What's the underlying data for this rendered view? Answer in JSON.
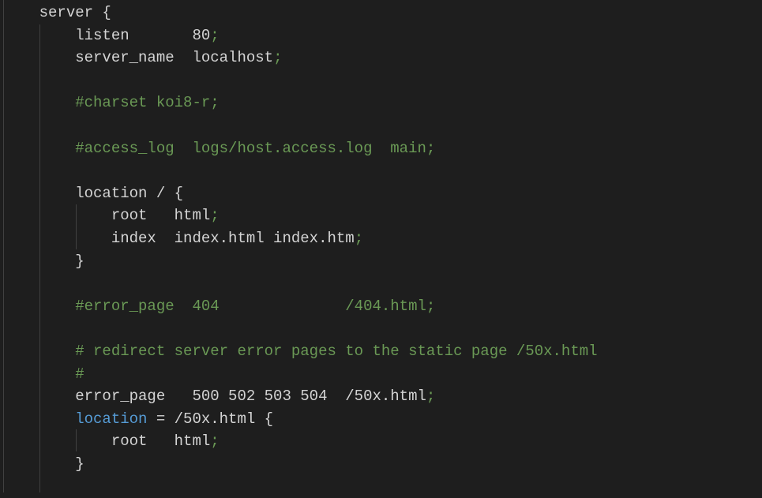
{
  "editor": {
    "language": "nginx",
    "colors": {
      "background": "#1e1e1e",
      "text": "#d4d4d4",
      "comment": "#6a9955",
      "keyword": "#569cd6",
      "punctuation": "#6a9955"
    },
    "lines": [
      [
        [
          "t",
          "    server {"
        ]
      ],
      [
        [
          "t",
          "        listen       80"
        ],
        [
          "p",
          ";"
        ]
      ],
      [
        [
          "t",
          "        server_name  localhost"
        ],
        [
          "p",
          ";"
        ]
      ],
      [],
      [
        [
          "c",
          "        #charset koi8-r;"
        ]
      ],
      [],
      [
        [
          "c",
          "        #access_log  logs/host.access.log  main;"
        ]
      ],
      [],
      [
        [
          "t",
          "        location / {"
        ]
      ],
      [
        [
          "t",
          "            root   html"
        ],
        [
          "p",
          ";"
        ]
      ],
      [
        [
          "t",
          "            index  index.html index.htm"
        ],
        [
          "p",
          ";"
        ]
      ],
      [
        [
          "t",
          "        }"
        ]
      ],
      [],
      [
        [
          "c",
          "        #error_page  404              /404.html;"
        ]
      ],
      [],
      [
        [
          "c",
          "        # redirect server error pages to the static page /50x.html"
        ]
      ],
      [
        [
          "c",
          "        #"
        ]
      ],
      [
        [
          "t",
          "        error_page   500 502 503 504  /50x.html"
        ],
        [
          "p",
          ";"
        ]
      ],
      [
        [
          "k",
          "        location"
        ],
        [
          "t",
          " = /50x.html {"
        ]
      ],
      [
        [
          "t",
          "            root   html"
        ],
        [
          "p",
          ";"
        ]
      ],
      [
        [
          "t",
          "        }"
        ]
      ],
      []
    ]
  }
}
